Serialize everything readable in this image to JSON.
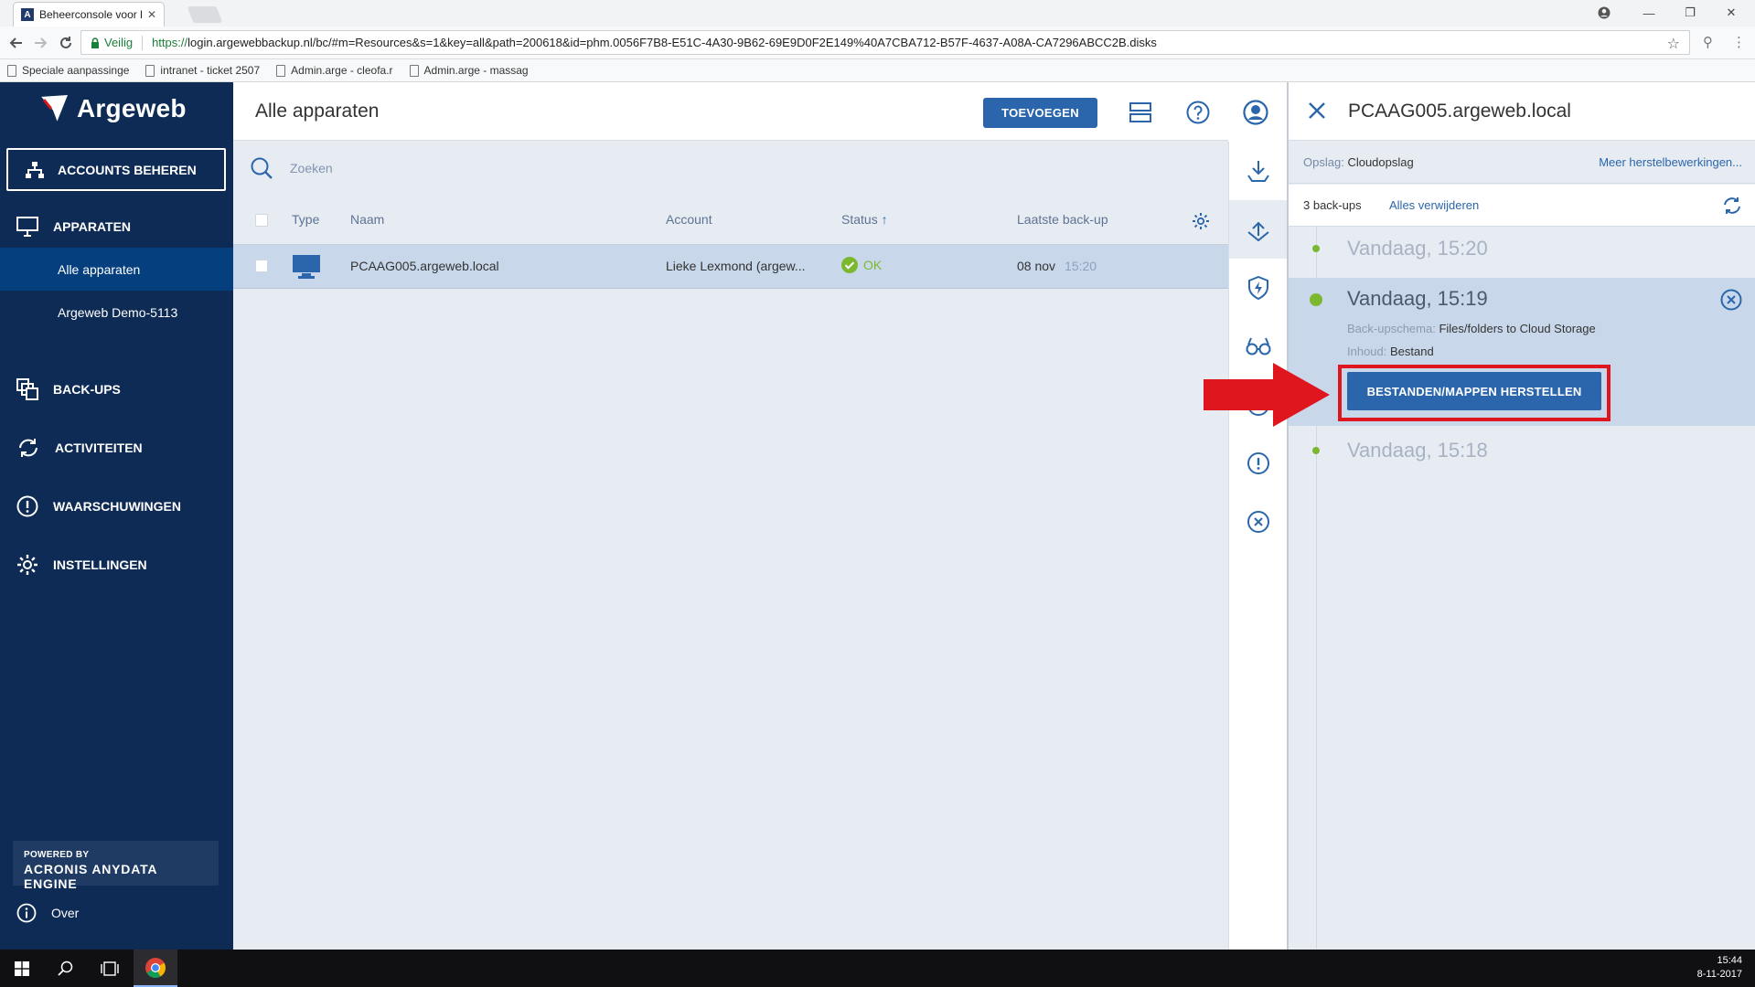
{
  "browser": {
    "tab_title": "Beheerconsole voor back",
    "secure_label": "Veilig",
    "url_scheme": "https://",
    "url_rest": "login.argewebbackup.nl/bc/#m=Resources&s=1&key=all&path=200618&id=phm.0056F7B8-E51C-4A30-9B62-69E9D0F2E149%40A7CBA712-B57F-4637-A08A-CA7296ABCC2B.disks",
    "bookmarks": [
      "Speciale aanpassinge",
      "intranet - ticket 2507",
      "Admin.arge - cleofa.r",
      "Admin.arge - massag"
    ]
  },
  "sidebar": {
    "brand": "Argeweb",
    "accounts_button": "ACCOUNTS BEHEREN",
    "items": [
      {
        "label": "APPARATEN"
      },
      {
        "label": "BACK-UPS"
      },
      {
        "label": "ACTIVITEITEN"
      },
      {
        "label": "WAARSCHUWINGEN"
      },
      {
        "label": "INSTELLINGEN"
      }
    ],
    "sub_items": [
      "Alle apparaten",
      "Argeweb Demo-5113"
    ],
    "powered_line1": "POWERED BY",
    "powered_line2": "ACRONIS ANYDATA ENGINE",
    "over": "Over"
  },
  "main": {
    "title": "Alle apparaten",
    "add_button": "TOEVOEGEN",
    "search_placeholder": "Zoeken",
    "columns": {
      "type": "Type",
      "name": "Naam",
      "account": "Account",
      "status": "Status",
      "last_backup": "Laatste back-up"
    },
    "rows": [
      {
        "name": "PCAAG005.argeweb.local",
        "account": "Lieke Lexmond (argew...",
        "status": "OK",
        "last_date": "08 nov",
        "last_time": "15:20"
      }
    ]
  },
  "panel": {
    "title": "PCAAG005.argeweb.local",
    "storage_label": "Opslag:",
    "storage_value": "Cloudopslag",
    "more_restore": "Meer herstelbewerkingen...",
    "backup_count": "3 back-ups",
    "delete_all": "Alles verwijderen",
    "backups": [
      {
        "time": "Vandaag, 15:20"
      },
      {
        "time": "Vandaag, 15:19",
        "schema_label": "Back-upschema:",
        "schema_value": "Files/folders to Cloud Storage",
        "content_label": "Inhoud:",
        "content_value": "Bestand",
        "restore_button": "BESTANDEN/MAPPEN HERSTELLEN"
      },
      {
        "time": "Vandaag, 15:18"
      }
    ]
  },
  "taskbar": {
    "time": "15:44",
    "date": "8-11-2017"
  },
  "colors": {
    "sidebar": "#0e2b55",
    "accent": "#2b66ac",
    "ok": "#7cb82f",
    "highlight": "#e0161f"
  }
}
